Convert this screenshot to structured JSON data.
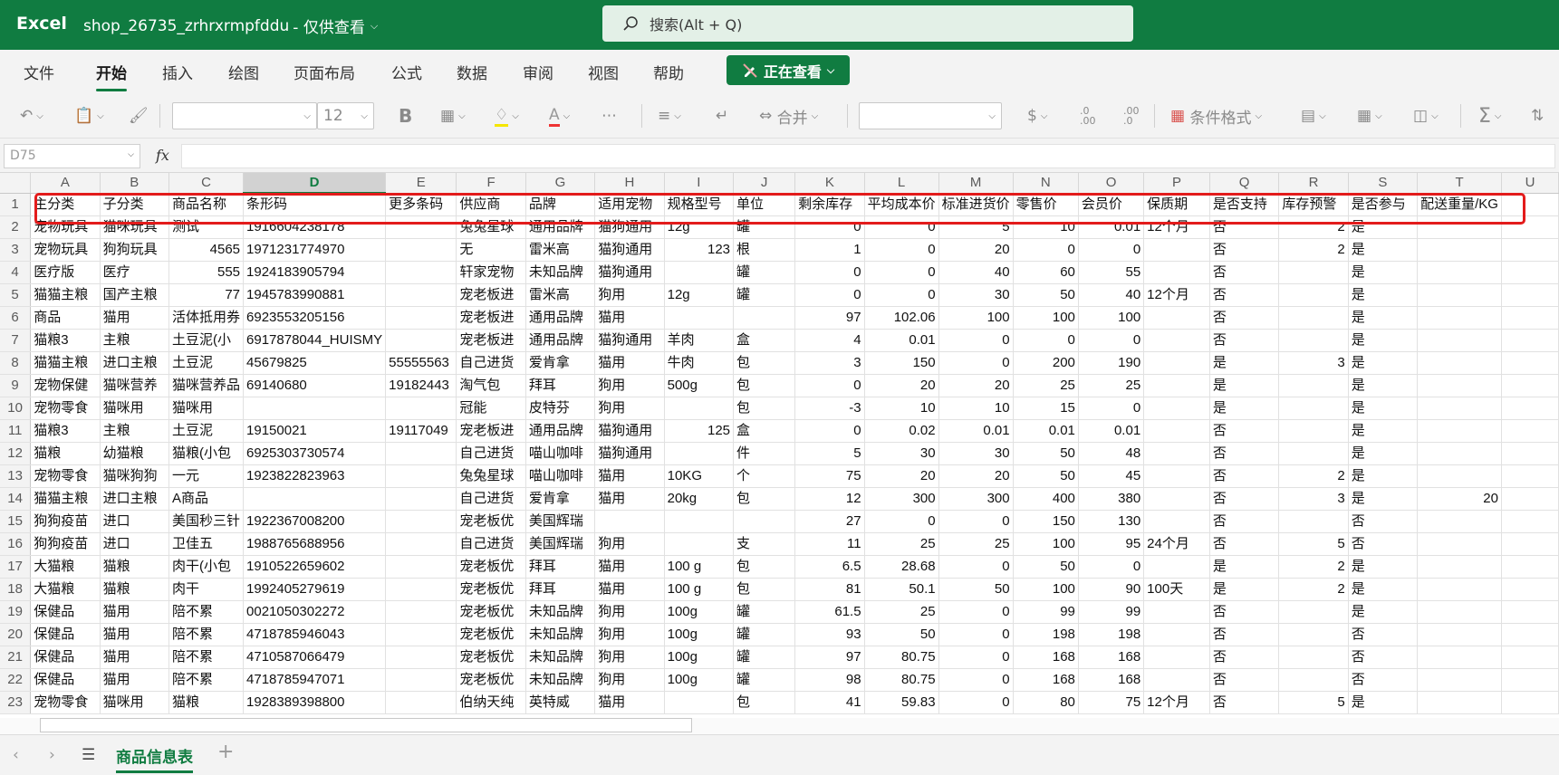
{
  "titlebar": {
    "app": "Excel",
    "document": "shop_26735_zrhrxrmpfddu",
    "mode": "- 仅供查看",
    "search_placeholder": "搜索(Alt + Q)",
    "accent": "#107c41"
  },
  "menu": {
    "tabs": [
      "文件",
      "开始",
      "插入",
      "绘图",
      "页面布局",
      "公式",
      "数据",
      "审阅",
      "视图",
      "帮助"
    ],
    "active": "开始",
    "viewing_label": "正在查看"
  },
  "ribbon": {
    "font_size": "12",
    "merge_label": "合并",
    "currency_symbol": "$",
    "cond_format_label": "条件格式",
    "dec_increase": ".0\n.00",
    "dec_decrease": ".00\n.0"
  },
  "formula_bar": {
    "name_box": "D75",
    "fx": "fx",
    "value": ""
  },
  "grid": {
    "columns": [
      "A",
      "B",
      "C",
      "D",
      "E",
      "F",
      "G",
      "H",
      "I",
      "J",
      "K",
      "L",
      "M",
      "N",
      "O",
      "P",
      "Q",
      "R",
      "S",
      "T",
      "U"
    ],
    "selected_column": "D",
    "highlight_color": "#e31b1b",
    "rows": [
      [
        "1",
        "主分类",
        "子分类",
        "商品名称",
        "条形码",
        "更多条码",
        "供应商",
        "品牌",
        "适用宠物",
        "规格型号",
        "单位",
        "剩余库存",
        "平均成本价",
        "标准进货价",
        "零售价",
        "会员价",
        "保质期",
        "是否支持",
        "库存预警",
        "是否参与",
        "配送重量/KG",
        ""
      ],
      [
        "2",
        "宠物玩具",
        "猫咪玩具",
        "测试",
        "1916604238178",
        "",
        "兔兔星球",
        "通用品牌",
        "猫狗通用",
        "12g",
        "罐",
        "0",
        "0",
        "5",
        "10",
        "0.01",
        "12个月",
        "否",
        "2",
        "是",
        "",
        ""
      ],
      [
        "3",
        "宠物玩具",
        "狗狗玩具",
        "4565",
        "1971231774970",
        "",
        "无",
        "雷米高",
        "猫狗通用",
        "123",
        "根",
        "1",
        "0",
        "20",
        "0",
        "0",
        "",
        "否",
        "2",
        "是",
        "",
        ""
      ],
      [
        "4",
        "医疗版",
        "医疗",
        "555",
        "1924183905794",
        "",
        "轩家宠物",
        "未知品牌",
        "猫狗通用",
        "",
        "罐",
        "0",
        "0",
        "40",
        "60",
        "55",
        "",
        "否",
        "",
        "是",
        "",
        ""
      ],
      [
        "5",
        "猫猫主粮",
        "国产主粮",
        "77",
        "1945783990881",
        "",
        "宠老板进",
        "雷米高",
        "狗用",
        "12g",
        "罐",
        "0",
        "0",
        "30",
        "50",
        "40",
        "12个月",
        "否",
        "",
        "是",
        "",
        ""
      ],
      [
        "6",
        "商品",
        "猫用",
        "活体抵用券",
        "6923553205156",
        "",
        "宠老板进",
        "通用品牌",
        "猫用",
        "",
        "",
        "97",
        "102.06",
        "100",
        "100",
        "100",
        "",
        "否",
        "",
        "是",
        "",
        ""
      ],
      [
        "7",
        "猫粮3",
        "主粮",
        "土豆泥(小",
        "6917878044_HUISMY",
        "",
        "宠老板进",
        "通用品牌",
        "猫狗通用",
        "羊肉",
        "盒",
        "4",
        "0.01",
        "0",
        "0",
        "0",
        "",
        "否",
        "",
        "是",
        "",
        ""
      ],
      [
        "8",
        "猫猫主粮",
        "进口主粮",
        "土豆泥",
        "45679825",
        "55555563",
        "自己进货",
        "爱肯拿",
        "猫用",
        "牛肉",
        "包",
        "3",
        "150",
        "0",
        "200",
        "190",
        "",
        "是",
        "3",
        "是",
        "",
        ""
      ],
      [
        "9",
        "宠物保健",
        "猫咪营养",
        "猫咪营养品",
        "69140680",
        "19182443",
        "淘气包",
        "拜耳",
        "狗用",
        "500g",
        "包",
        "0",
        "20",
        "20",
        "25",
        "25",
        "",
        "是",
        "",
        "是",
        "",
        ""
      ],
      [
        "10",
        "宠物零食",
        "猫咪用",
        "猫咪用",
        "",
        "",
        "冠能",
        "皮特芬",
        "狗用",
        "",
        "包",
        "-3",
        "10",
        "10",
        "15",
        "0",
        "",
        "是",
        "",
        "是",
        "",
        ""
      ],
      [
        "11",
        "猫粮3",
        "主粮",
        "土豆泥",
        "19150021",
        "19117049",
        "宠老板进",
        "通用品牌",
        "猫狗通用",
        "125",
        "盒",
        "0",
        "0.02",
        "0.01",
        "0.01",
        "0.01",
        "",
        "否",
        "",
        "是",
        "",
        ""
      ],
      [
        "12",
        "猫粮",
        "幼猫粮",
        "猫粮(小包",
        "6925303730574",
        "",
        "自己进货",
        "喵山咖啡",
        "猫狗通用",
        "",
        "件",
        "5",
        "30",
        "30",
        "50",
        "48",
        "",
        "否",
        "",
        "是",
        "",
        ""
      ],
      [
        "13",
        "宠物零食",
        "猫咪狗狗",
        "一元",
        "1923822823963",
        "",
        "兔兔星球",
        "喵山咖啡",
        "猫用",
        "10KG",
        "个",
        "75",
        "20",
        "20",
        "50",
        "45",
        "",
        "否",
        "2",
        "是",
        "",
        ""
      ],
      [
        "14",
        "猫猫主粮",
        "进口主粮",
        "A商品",
        "",
        "",
        "自己进货",
        "爱肯拿",
        "猫用",
        "20kg",
        "包",
        "12",
        "300",
        "300",
        "400",
        "380",
        "",
        "否",
        "3",
        "是",
        "20",
        ""
      ],
      [
        "15",
        "狗狗疫苗",
        "进口",
        "美国秒三针",
        "1922367008200",
        "",
        "宠老板优",
        "美国辉瑞",
        "",
        "",
        "",
        "27",
        "0",
        "0",
        "150",
        "130",
        "",
        "否",
        "",
        "否",
        "",
        ""
      ],
      [
        "16",
        "狗狗疫苗",
        "进口",
        "卫佳五",
        "1988765688956",
        "",
        "自己进货",
        "美国辉瑞",
        "狗用",
        "",
        "支",
        "11",
        "25",
        "25",
        "100",
        "95",
        "24个月",
        "否",
        "5",
        "否",
        "",
        ""
      ],
      [
        "17",
        "大猫粮",
        "猫粮",
        "肉干(小包",
        "1910522659602",
        "",
        "宠老板优",
        "拜耳",
        "猫用",
        "100 g",
        "包",
        "6.5",
        "28.68",
        "0",
        "50",
        "0",
        "",
        "是",
        "2",
        "是",
        "",
        ""
      ],
      [
        "18",
        "大猫粮",
        "猫粮",
        "肉干",
        "1992405279619",
        "",
        "宠老板优",
        "拜耳",
        "猫用",
        "100 g",
        "包",
        "81",
        "50.1",
        "50",
        "100",
        "90",
        "100天",
        "是",
        "2",
        "是",
        "",
        ""
      ],
      [
        "19",
        "保健品",
        "猫用",
        "陪不累",
        "0021050302272",
        "",
        "宠老板优",
        "未知品牌",
        "狗用",
        "100g",
        "罐",
        "61.5",
        "25",
        "0",
        "99",
        "99",
        "",
        "否",
        "",
        "是",
        "",
        ""
      ],
      [
        "20",
        "保健品",
        "猫用",
        "陪不累",
        "4718785946043",
        "",
        "宠老板优",
        "未知品牌",
        "狗用",
        "100g",
        "罐",
        "93",
        "50",
        "0",
        "198",
        "198",
        "",
        "否",
        "",
        "否",
        "",
        ""
      ],
      [
        "21",
        "保健品",
        "猫用",
        "陪不累",
        "4710587066479",
        "",
        "宠老板优",
        "未知品牌",
        "狗用",
        "100g",
        "罐",
        "97",
        "80.75",
        "0",
        "168",
        "168",
        "",
        "否",
        "",
        "否",
        "",
        ""
      ],
      [
        "22",
        "保健品",
        "猫用",
        "陪不累",
        "4718785947071",
        "",
        "宠老板优",
        "未知品牌",
        "狗用",
        "100g",
        "罐",
        "98",
        "80.75",
        "0",
        "168",
        "168",
        "",
        "否",
        "",
        "否",
        "",
        ""
      ],
      [
        "23",
        "宠物零食",
        "猫咪用",
        "猫粮",
        "1928389398800",
        "",
        "伯纳天纯",
        "英特威",
        "猫用",
        "",
        "包",
        "41",
        "59.83",
        "0",
        "80",
        "75",
        "12个月",
        "否",
        "5",
        "是",
        "",
        ""
      ]
    ]
  },
  "sheets": {
    "active": "商品信息表",
    "add": "+"
  }
}
